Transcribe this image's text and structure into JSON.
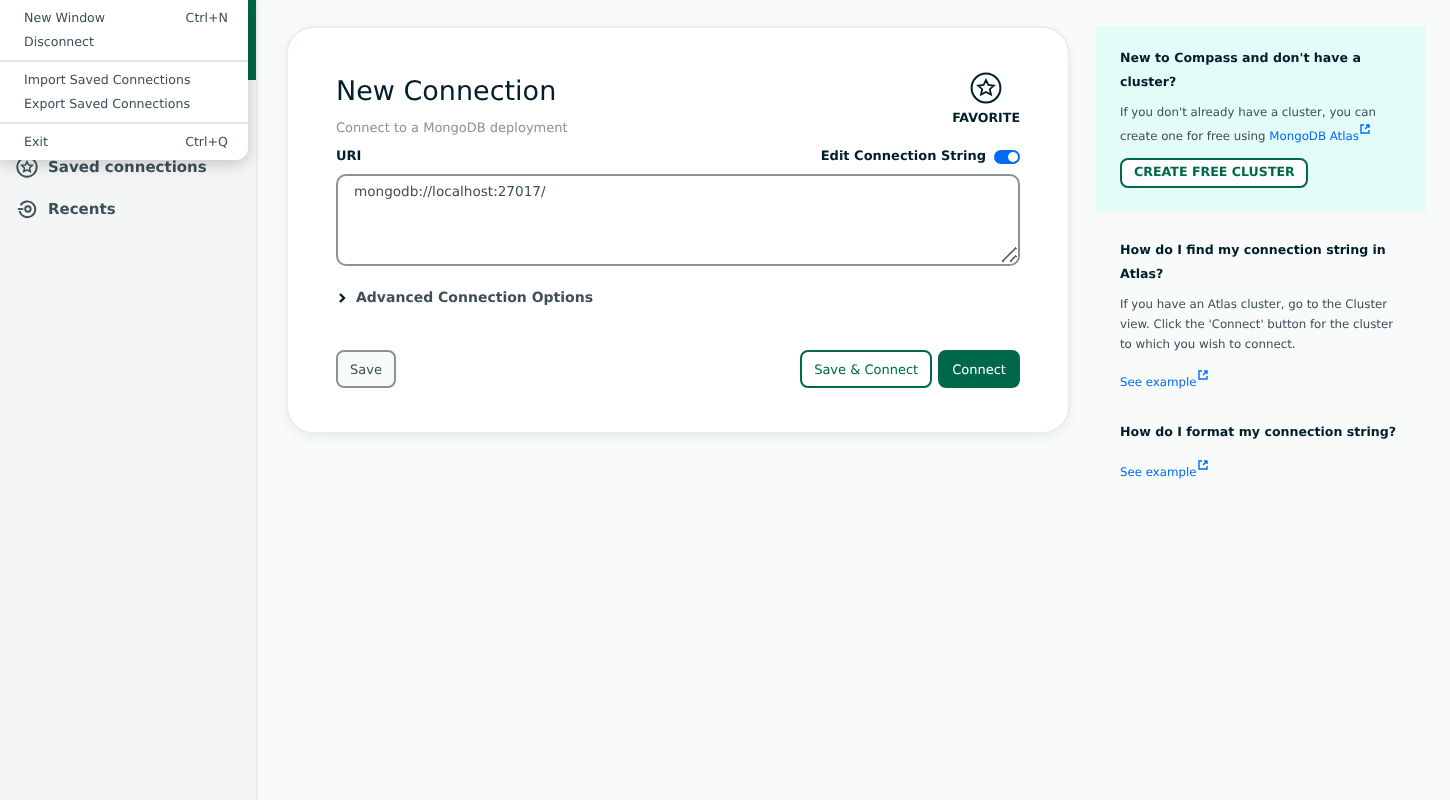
{
  "menu": {
    "groups": [
      [
        {
          "label": "New Window",
          "shortcut": "Ctrl+N"
        },
        {
          "label": "Disconnect"
        }
      ],
      [
        {
          "label": "Import Saved Connections"
        },
        {
          "label": "Export Saved Connections"
        }
      ],
      [
        {
          "label": "Exit",
          "shortcut": "Ctrl+Q"
        }
      ]
    ]
  },
  "sidebar": {
    "items": [
      {
        "label": "Saved connections",
        "kind": "saved"
      },
      {
        "label": "Recents",
        "kind": "recents"
      }
    ]
  },
  "form": {
    "title": "New Connection",
    "subtitle": "Connect to a MongoDB deployment",
    "favorite": {
      "label": "FAVORITE",
      "selected": false
    },
    "uri_label": "URI",
    "edit_toggle": {
      "label": "Edit Connection String",
      "on": true
    },
    "uri_value": "mongodb://localhost:27017/",
    "advanced": {
      "label": "Advanced Connection Options",
      "expanded": false
    },
    "buttons": [
      {
        "label": "Save",
        "kind": "plain"
      },
      {
        "label": "Save & Connect",
        "kind": "outline"
      },
      {
        "label": "Connect",
        "kind": "primary"
      }
    ]
  },
  "help": {
    "promo": {
      "title": "New to Compass and don't have a cluster?",
      "text": "If you don't already have a cluster, you can create one for free using",
      "link": "MongoDB Atlas",
      "button": "CREATE FREE CLUSTER"
    },
    "sections": [
      {
        "title": "How do I find my connection string in Atlas?",
        "text": "If you have an Atlas cluster, go to the Cluster view. Click the 'Connect' button for the cluster to which you wish to connect.",
        "link": "See example"
      },
      {
        "title": "How do I format my connection string?",
        "link": "See example"
      }
    ]
  }
}
